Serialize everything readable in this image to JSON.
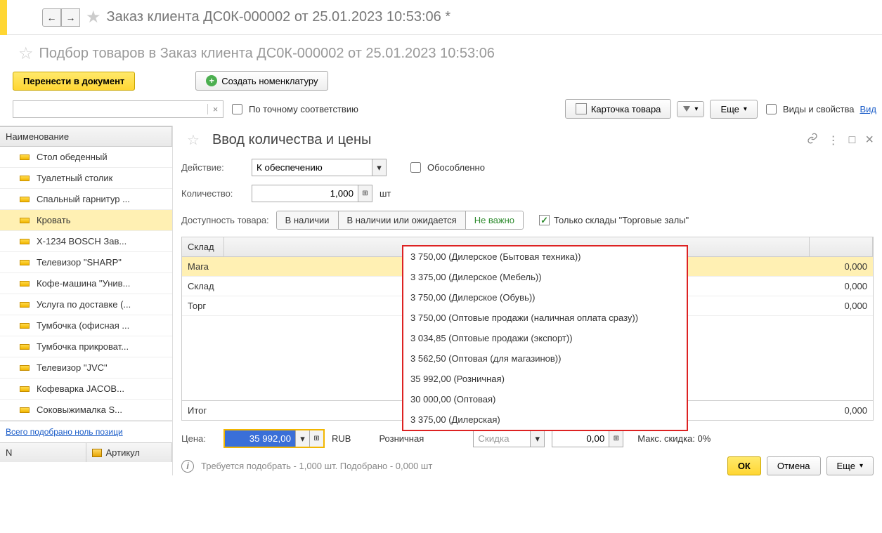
{
  "topbar": {
    "title": "Заказ клиента ДС0К-000002 от 25.01.2023 10:53:06 *"
  },
  "subheader": {
    "title": "Подбор товаров в Заказ клиента ДС0К-000002 от 25.01.2023 10:53:06"
  },
  "buttons": {
    "transfer": "Перенести в документ",
    "create_nom": "Создать номенклатуру",
    "exact_match": "По точному соответствию",
    "card": "Карточка товара",
    "more": "Еще",
    "types_props": "Виды и свойства",
    "types_link": "Вид"
  },
  "sidebar": {
    "header": "Наименование",
    "items": [
      "Стол обеденный",
      "Туалетный столик",
      "Спальный гарнитур ...",
      "Кровать",
      "X-1234 BOSCH Зав...",
      "Телевизор \"SHARP\"",
      "Кофе-машина \"Унив...",
      "Услуга по доставке (...",
      "Тумбочка (офисная ...",
      "Тумбочка прикроват...",
      "Телевизор \"JVC\"",
      "Кофеварка JACOB...",
      "Соковыжималка  S..."
    ],
    "selected_index": 3,
    "summary": "Всего подобрано ноль позици",
    "col_n": "N",
    "col_art": "Артикул"
  },
  "dialog": {
    "title": "Ввод количества и цены",
    "action_label": "Действие:",
    "action_value": "К обеспечению",
    "separate": "Обособленно",
    "qty_label": "Количество:",
    "qty_value": "1,000",
    "qty_unit": "шт",
    "avail_label": "Доступность товара:",
    "avail_opts": [
      "В наличии",
      "В наличии или ожидается",
      "Не важно"
    ],
    "only_wh": "Только склады \"Торговые залы\"",
    "table": {
      "col_sklad": "Склад",
      "rows": [
        {
          "name": "Мага",
          "val": "0,000"
        },
        {
          "name": "Склад",
          "val": "0,000"
        },
        {
          "name": "Торг",
          "val": "0,000"
        }
      ],
      "total_label": "Итог",
      "total_val": "0,000"
    },
    "dropdown": [
      "3 750,00 (Дилерское (Бытовая техника))",
      "3 375,00 (Дилерское (Мебель))",
      "3 750,00 (Дилерское (Обувь))",
      "3 750,00 (Оптовые продажи (наличная оплата сразу))",
      "3 034,85 (Оптовые продажи (экспорт))",
      "3 562,50 (Оптовая (для магазинов))",
      "35 992,00 (Розничная)",
      "30 000,00 (Оптовая)",
      "3 375,00 (Дилерская)"
    ],
    "price_label": "Цена:",
    "price_value": "35 992,00",
    "currency": "RUB",
    "price_type": "Розничная",
    "discount_label": "Скидка",
    "discount_val": "0,00",
    "max_discount": "Макс. скидка: 0%",
    "info_text": "Требуется подобрать - 1,000 шт. Подобрано - 0,000 шт",
    "ok": "ОК",
    "cancel": "Отмена",
    "more2": "Еще"
  }
}
